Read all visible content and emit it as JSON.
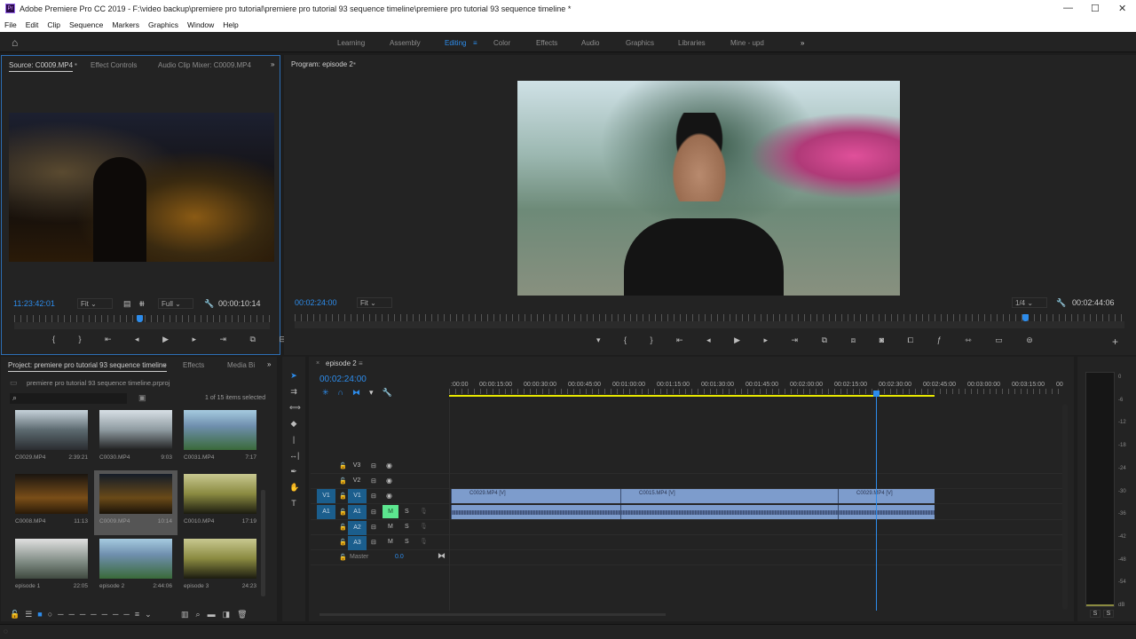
{
  "window": {
    "logo": "Pr",
    "title": "Adobe Premiere Pro CC 2019 - F:\\video backup\\premiere pro tutorial\\premiere pro tutorial 93 sequence timeline\\premiere pro tutorial 93 sequence timeline *",
    "minimize": "—",
    "maximize": "☐",
    "close": "✕"
  },
  "menu": [
    "File",
    "Edit",
    "Clip",
    "Sequence",
    "Markers",
    "Graphics",
    "Window",
    "Help"
  ],
  "workspaces": {
    "items": [
      "Learning",
      "Assembly",
      "Editing",
      "Color",
      "Effects",
      "Audio",
      "Graphics",
      "Libraries",
      "Mine - upd"
    ],
    "active": "Editing",
    "more": "»"
  },
  "source": {
    "tabs": [
      "Source: C0009.MP4",
      "Effect Controls",
      "Audio Clip Mixer: C0009.MP4"
    ],
    "more": "»",
    "timecode": "11:23:42:01",
    "zoom": "Fit",
    "resolution": "Full",
    "duration": "00:00:10:14",
    "playhead_fraction": 0.49
  },
  "program": {
    "tab": "Program: episode 2",
    "timecode": "00:02:24:00",
    "zoom": "Fit",
    "resolution": "1/4",
    "duration": "00:02:44:06",
    "playhead_fraction": 0.88
  },
  "project": {
    "tabs": [
      "Project: premiere pro tutorial 93 sequence timeline",
      "Effects",
      "Media Bi"
    ],
    "more": "»",
    "file": "premiere pro tutorial 93 sequence timeline.prproj",
    "search_placeholder": "",
    "selection": "1 of 15 items selected",
    "items": [
      {
        "name": "C0029.MP4",
        "duration": "2:39:21"
      },
      {
        "name": "C0030.MP4",
        "duration": "9:03"
      },
      {
        "name": "C0031.MP4",
        "duration": "7:17"
      },
      {
        "name": "C0008.MP4",
        "duration": "11:13"
      },
      {
        "name": "C0009.MP4",
        "duration": "10:14"
      },
      {
        "name": "C0010.MP4",
        "duration": "17:19"
      },
      {
        "name": "episode 1",
        "duration": "22:05"
      },
      {
        "name": "episode 2",
        "duration": "2:44:06"
      },
      {
        "name": "episode 3",
        "duration": "24:23"
      }
    ]
  },
  "timeline": {
    "tab": "episode 2",
    "close": "×",
    "timecode": "00:02:24:00",
    "ruler": [
      ":00:00",
      "00:00:15:00",
      "00:00:30:00",
      "00:00:45:00",
      "00:01:00:00",
      "00:01:15:00",
      "00:01:30:00",
      "00:01:45:00",
      "00:02:00:00",
      "00:02:15:00",
      "00:02:30:00",
      "00:02:45:00",
      "00:03:00:00",
      "00:03:15:00",
      "00"
    ],
    "tracks": {
      "v3": "V3",
      "v2": "V2",
      "v1": "V1",
      "a1": "A1",
      "a2": "A2",
      "a3": "A3",
      "src_v1": "V1",
      "src_a1": "A1",
      "mute": "M",
      "solo": "S",
      "master": "Master",
      "master_value": "0.0"
    },
    "clips": [
      "C0029.MP4 [V]",
      "C0015.MP4 [V]",
      "C0029.MP4 [V]"
    ]
  },
  "meter": {
    "scale": [
      "0",
      "-6",
      "-12",
      "-18",
      "-24",
      "-30",
      "-36",
      "-42",
      "-48",
      "-54",
      "dB"
    ],
    "solo": [
      "S",
      "S"
    ]
  },
  "colors": {
    "accent": "#2d8ceb",
    "clip": "#7d9ccc",
    "mute_active": "#5ce68f"
  }
}
